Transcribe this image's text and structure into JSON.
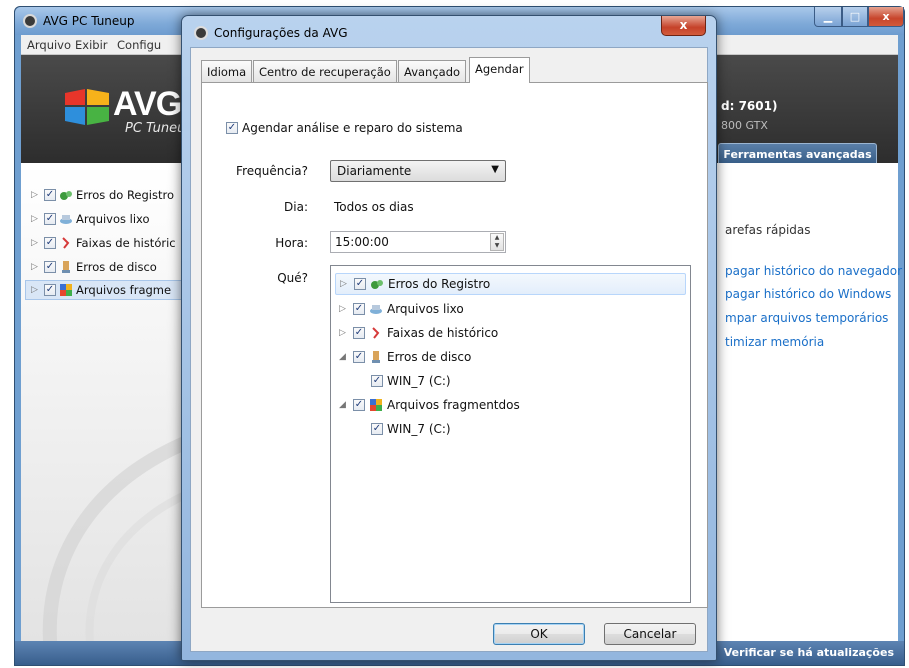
{
  "main_window": {
    "title": "AVG PC Tuneup",
    "menu": [
      "Arquivo",
      "Exibir",
      "Configu"
    ],
    "banner": {
      "brand": "AVG",
      "product": "PC Tuneu",
      "system_line1": "d: 7601)",
      "system_line2": "800 GTX",
      "tools_tab": "Ferramentas avançadas"
    },
    "tree": [
      {
        "label": "Erros do Registro",
        "icon": "registry-icon",
        "checked": true
      },
      {
        "label": "Arquivos lixo",
        "icon": "junk-files-icon",
        "checked": true
      },
      {
        "label": "Faixas de históric",
        "icon": "history-traces-icon",
        "checked": true
      },
      {
        "label": "Erros de disco",
        "icon": "disk-errors-icon",
        "checked": true
      },
      {
        "label": "Arquivos fragme",
        "icon": "fragmented-files-icon",
        "checked": true
      }
    ],
    "quick_tasks": {
      "title": "arefas rápidas",
      "links": [
        "pagar histórico do navegador",
        "pagar histórico do Windows",
        "mpar arquivos temporários",
        "timizar memória"
      ]
    },
    "status_link": "Verificar se há atualizações"
  },
  "dialog": {
    "title": "Configurações da AVG",
    "close_label": "x",
    "tabs": [
      {
        "label": "Idioma"
      },
      {
        "label": "Centro de recuperação"
      },
      {
        "label": "Avançado"
      },
      {
        "label": "Agendar"
      }
    ],
    "schedule_checkbox": "Agendar análise e reparo do sistema",
    "frequency_label": "Frequência?",
    "frequency_value": "Diariamente",
    "day_label": "Dia:",
    "day_value": "Todos os dias",
    "time_label": "Hora:",
    "time_value": "15:00:00",
    "what_label": "Qué?",
    "what_tree": [
      {
        "label": "Erros do Registro",
        "expander": "collapsed",
        "checked": true,
        "icon": "registry-icon"
      },
      {
        "label": "Arquivos lixo",
        "expander": "collapsed",
        "checked": true,
        "icon": "junk-files-icon"
      },
      {
        "label": "Faixas de histórico",
        "expander": "collapsed",
        "checked": true,
        "icon": "history-traces-icon"
      },
      {
        "label": "Erros de disco",
        "expander": "expanded",
        "checked": true,
        "icon": "disk-errors-icon"
      },
      {
        "label": "WIN_7 (C:)",
        "expander": "none",
        "checked": true,
        "icon": ""
      },
      {
        "label": "Arquivos fragmentdos",
        "expander": "expanded",
        "checked": true,
        "icon": "fragmented-files-icon"
      },
      {
        "label": "WIN_7 (C:)",
        "expander": "none",
        "checked": true,
        "icon": ""
      }
    ],
    "ok_label": "OK",
    "cancel_label": "Cancelar"
  },
  "colors": {
    "link": "#1a6fc8",
    "titlebar": "#7ea9d8",
    "close_red": "#c7452b",
    "banner_dark": "#2d2d2d"
  }
}
